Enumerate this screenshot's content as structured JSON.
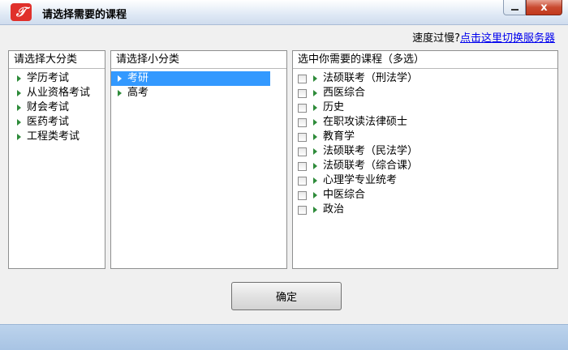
{
  "window": {
    "title": "请选择需要的课程",
    "icon": "app-logo-icon",
    "close_label": "x",
    "accent": "#c94a30"
  },
  "speed": {
    "prefix": "速度过慢?",
    "link": "点击这里切换服务器"
  },
  "major": {
    "header": "请选择大分类",
    "items": [
      "学历考试",
      "从业资格考试",
      "财会考试",
      "医药考试",
      "工程类考试"
    ]
  },
  "minor": {
    "header": "请选择小分类",
    "items": [
      "考研",
      "高考"
    ],
    "selected": "考研",
    "selection_color": "#3399ff"
  },
  "courses": {
    "header": "选中你需要的课程（多选）",
    "items": [
      "法硕联考（刑法学）",
      "西医综合",
      "历史",
      "在职攻读法律硕士",
      "教育学",
      "法硕联考（民法学）",
      "法硕联考（综合课）",
      "心理学专业统考",
      "中医综合",
      "政治"
    ]
  },
  "buttons": {
    "ok": "确定"
  }
}
